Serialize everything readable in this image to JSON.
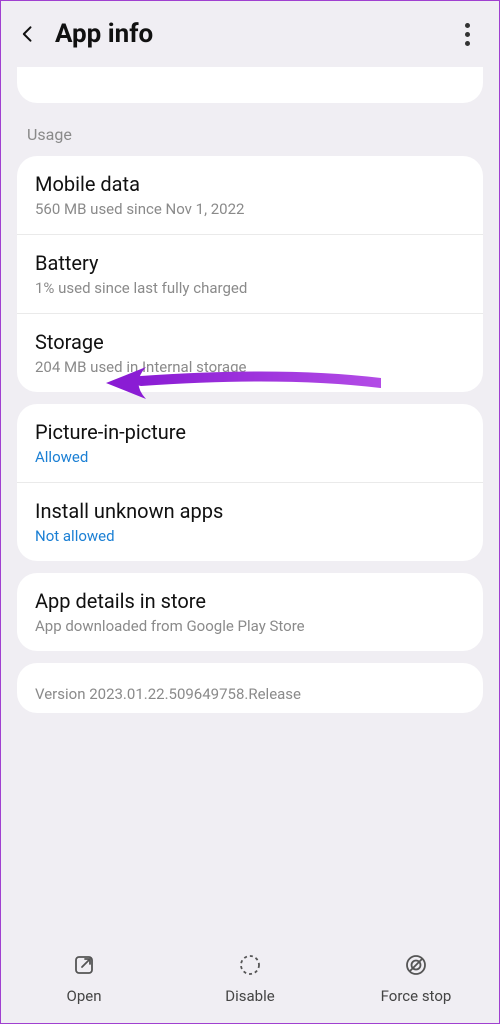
{
  "header": {
    "title": "App info"
  },
  "section_label": "Usage",
  "usage": {
    "mobile_data": {
      "title": "Mobile data",
      "sub": "560 MB used since Nov 1, 2022"
    },
    "battery": {
      "title": "Battery",
      "sub": "1% used since last fully charged"
    },
    "storage": {
      "title": "Storage",
      "sub": "204 MB used in Internal storage"
    }
  },
  "perms": {
    "pip": {
      "title": "Picture-in-picture",
      "status": "Allowed"
    },
    "unknown": {
      "title": "Install unknown apps",
      "status": "Not allowed"
    }
  },
  "store": {
    "title": "App details in store",
    "sub": "App downloaded from Google Play Store"
  },
  "version": "Version 2023.01.22.509649758.Release",
  "bottom": {
    "open": "Open",
    "disable": "Disable",
    "force_stop": "Force stop"
  },
  "colors": {
    "accent_arrow": "#8a1cd4",
    "link": "#1a7fd4"
  }
}
